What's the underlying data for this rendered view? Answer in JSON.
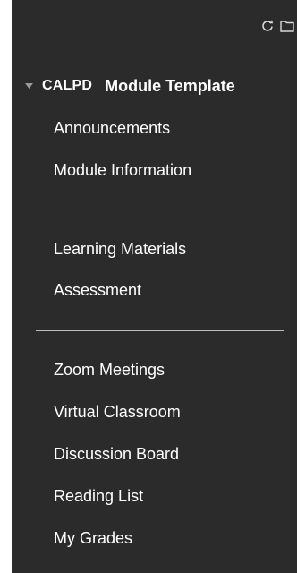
{
  "toolbar": {
    "refresh_icon": "refresh-icon",
    "folder_icon": "folder-icon"
  },
  "course": {
    "code": "CALPD",
    "name": "Module Template"
  },
  "menu": {
    "group1": [
      "Announcements",
      "Module Information"
    ],
    "group2": [
      "Learning Materials",
      "Assessment"
    ],
    "group3": [
      "Zoom Meetings",
      "Virtual Classroom",
      "Discussion Board",
      "Reading List",
      "My Grades"
    ]
  },
  "colors": {
    "background": "#2b2b2b",
    "text": "#ffffff",
    "divider": "#bdbdbd"
  }
}
